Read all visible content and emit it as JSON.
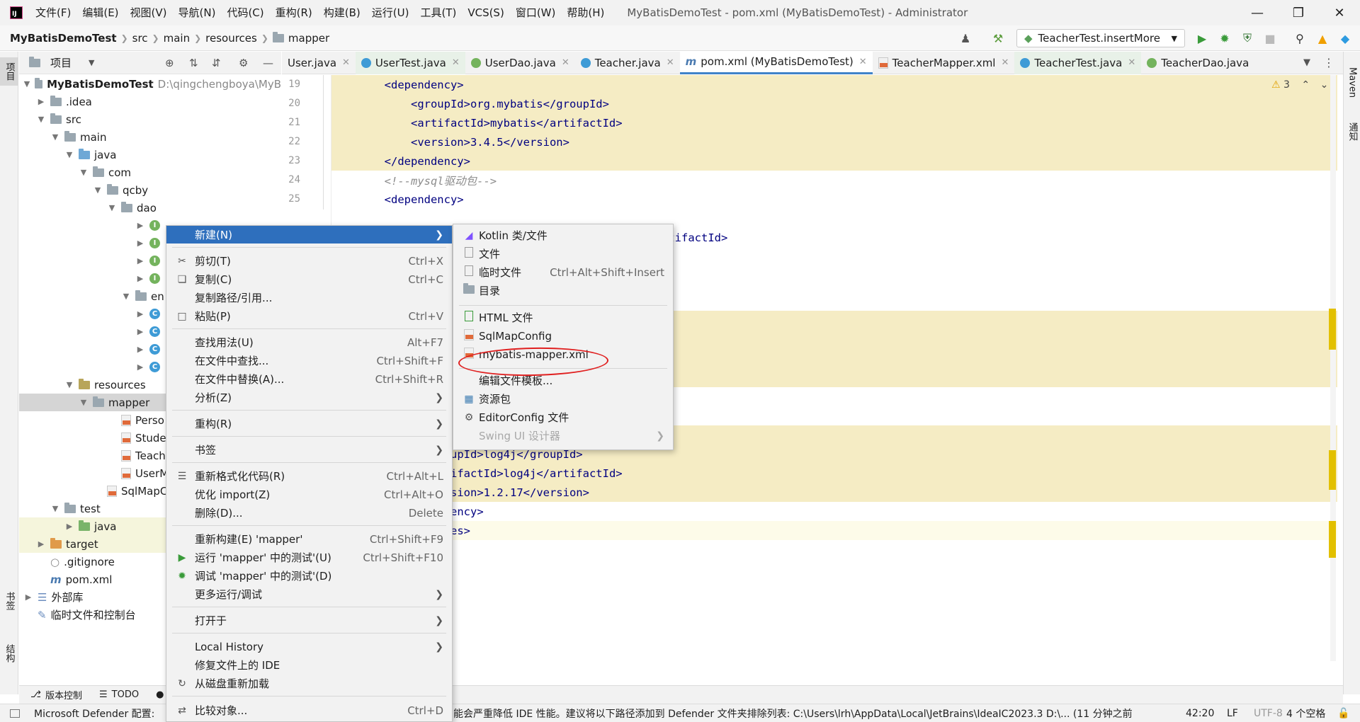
{
  "window": {
    "title": "MyBatisDemoTest - pom.xml (MyBatisDemoTest) - Administrator",
    "menu": [
      "文件(F)",
      "编辑(E)",
      "视图(V)",
      "导航(N)",
      "代码(C)",
      "重构(R)",
      "构建(B)",
      "运行(U)",
      "工具(T)",
      "VCS(S)",
      "窗口(W)",
      "帮助(H)"
    ]
  },
  "breadcrumb": [
    "MyBatisDemoTest",
    "src",
    "main",
    "resources",
    "mapper"
  ],
  "run_config": "TeacherTest.insertMore",
  "left_strip": {
    "top": "项目",
    "middle": "书签",
    "bottom": "结构"
  },
  "right_strip": {
    "maven": "Maven",
    "notifications": "通知"
  },
  "project_panel": {
    "title": "项目",
    "tree": [
      {
        "label": "MyBatisDemoTest",
        "hint": "D:\\qingchengboya\\MyB"
      },
      {
        "label": ".idea"
      },
      {
        "label": "src"
      },
      {
        "label": "main"
      },
      {
        "label": "java"
      },
      {
        "label": "com"
      },
      {
        "label": "qcby"
      },
      {
        "label": "dao"
      },
      {
        "label": "I"
      },
      {
        "label": "I"
      },
      {
        "label": "I"
      },
      {
        "label": "I"
      },
      {
        "label": "en"
      },
      {
        "label": "C"
      },
      {
        "label": "C"
      },
      {
        "label": "C"
      },
      {
        "label": "C"
      },
      {
        "label": "resources"
      },
      {
        "label": "mapper"
      },
      {
        "label": "Perso"
      },
      {
        "label": "Stude"
      },
      {
        "label": "Teach"
      },
      {
        "label": "UserM"
      },
      {
        "label": "SqlMapC"
      },
      {
        "label": "test"
      },
      {
        "label": "java"
      },
      {
        "label": "target"
      },
      {
        "label": ".gitignore"
      },
      {
        "label": "pom.xml"
      },
      {
        "label": "外部库"
      },
      {
        "label": "临时文件和控制台"
      }
    ]
  },
  "editor_tabs": [
    {
      "label": "User.java"
    },
    {
      "label": "UserTest.java"
    },
    {
      "label": "UserDao.java"
    },
    {
      "label": "Teacher.java"
    },
    {
      "label": "pom.xml (MyBatisDemoTest)"
    },
    {
      "label": "TeacherMapper.xml"
    },
    {
      "label": "TeacherTest.java"
    },
    {
      "label": "TeacherDao.java"
    }
  ],
  "editor": {
    "warnings": "3",
    "line_numbers": [
      "19",
      "20",
      "21",
      "22",
      "23",
      "24",
      "25"
    ],
    "lines": [
      {
        "text": "        <dependency>"
      },
      {
        "text": "            <groupId>org.mybatis</groupId>"
      },
      {
        "text": "            <artifactId>mybatis</artifactId>"
      },
      {
        "text": "            <version>3.4.5</version>"
      },
      {
        "text": "        </dependency>"
      },
      {
        "text": "        <!--mysql驱动包-->"
      },
      {
        "text": "        <dependency>"
      },
      {
        "text": "rtifactId>"
      },
      {
        "text": "upId>log4j</groupId>"
      },
      {
        "text": "ifactId>log4j</artifactId>"
      },
      {
        "text": "sion>1.2.17</version>"
      },
      {
        "text": "ency>"
      },
      {
        "text": "es>"
      }
    ]
  },
  "context_menu": {
    "items": [
      {
        "label": "新建(N)",
        "shortcut": ""
      },
      {
        "label": "剪切(T)",
        "shortcut": "Ctrl+X"
      },
      {
        "label": "复制(C)",
        "shortcut": "Ctrl+C"
      },
      {
        "label": "复制路径/引用...",
        "shortcut": ""
      },
      {
        "label": "粘贴(P)",
        "shortcut": "Ctrl+V"
      },
      {
        "label": "查找用法(U)",
        "shortcut": "Alt+F7"
      },
      {
        "label": "在文件中查找...",
        "shortcut": "Ctrl+Shift+F"
      },
      {
        "label": "在文件中替换(A)...",
        "shortcut": "Ctrl+Shift+R"
      },
      {
        "label": "分析(Z)",
        "shortcut": ""
      },
      {
        "label": "重构(R)",
        "shortcut": ""
      },
      {
        "label": "书签",
        "shortcut": ""
      },
      {
        "label": "重新格式化代码(R)",
        "shortcut": "Ctrl+Alt+L"
      },
      {
        "label": "优化 import(Z)",
        "shortcut": "Ctrl+Alt+O"
      },
      {
        "label": "删除(D)...",
        "shortcut": "Delete"
      },
      {
        "label": "重新构建(E) 'mapper'",
        "shortcut": "Ctrl+Shift+F9"
      },
      {
        "label": "运行 'mapper' 中的测试'(U)",
        "shortcut": "Ctrl+Shift+F10"
      },
      {
        "label": "调试 'mapper' 中的测试'(D)",
        "shortcut": ""
      },
      {
        "label": "更多运行/调试",
        "shortcut": ""
      },
      {
        "label": "打开于",
        "shortcut": ""
      },
      {
        "label": "Local History",
        "shortcut": ""
      },
      {
        "label": "修复文件上的 IDE",
        "shortcut": ""
      },
      {
        "label": "从磁盘重新加载",
        "shortcut": ""
      },
      {
        "label": "比较对象...",
        "shortcut": "Ctrl+D"
      }
    ]
  },
  "submenu": {
    "items": [
      {
        "label": "Kotlin 类/文件",
        "shortcut": ""
      },
      {
        "label": "文件",
        "shortcut": ""
      },
      {
        "label": "临时文件",
        "shortcut": "Ctrl+Alt+Shift+Insert"
      },
      {
        "label": "目录",
        "shortcut": ""
      },
      {
        "label": "HTML 文件",
        "shortcut": ""
      },
      {
        "label": "SqlMapConfig",
        "shortcut": ""
      },
      {
        "label": "mybatis-mapper.xml",
        "shortcut": ""
      },
      {
        "label": "编辑文件模板...",
        "shortcut": ""
      },
      {
        "label": "资源包",
        "shortcut": ""
      },
      {
        "label": "EditorConfig 文件",
        "shortcut": ""
      },
      {
        "label": "Swing UI 设计器",
        "shortcut": ""
      }
    ]
  },
  "bottom_tools": [
    "版本控制",
    "TODO"
  ],
  "status": {
    "message_left": "Microsoft Defender 配置:",
    "message_right": "能会严重降低 IDE 性能。建议将以下路径添加到 Defender 文件夹排除列表: C:\\Users\\lrh\\AppData\\Local\\JetBrains\\IdeaIC2023.3 D:\\... (11 分钟之前",
    "position": "42:20",
    "line_sep": "LF",
    "encoding": "UTF-8",
    "indent": "4 个空格"
  },
  "colors": {
    "accent": "#2e6fbd",
    "highlight_line": "#f5ecc4",
    "annotation_circle": "#e02020"
  }
}
